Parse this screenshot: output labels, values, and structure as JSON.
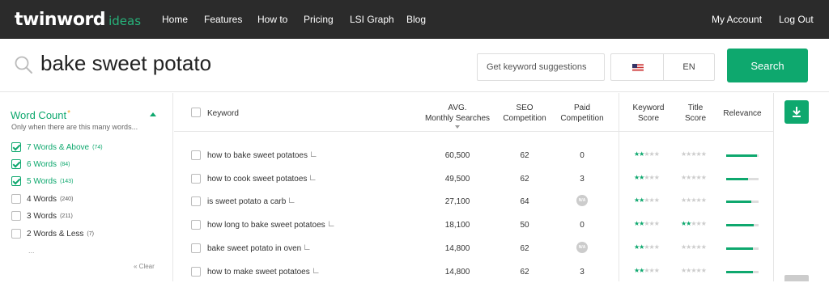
{
  "nav": {
    "logo_main": "twinword",
    "logo_sub": "ideas",
    "links": [
      "Home",
      "Features",
      "How to",
      "Pricing",
      "LSI Graph",
      "Blog"
    ],
    "account": "My Account",
    "logout": "Log Out"
  },
  "search": {
    "query": "bake sweet potato",
    "suggest_placeholder": "Get keyword suggestions",
    "language": "EN",
    "button": "Search"
  },
  "sidebar": {
    "title": "Word Count",
    "required_mark": "*",
    "subtitle": "Only when there are this many words...",
    "items": [
      {
        "label": "7 Words & Above",
        "count": "(74)",
        "checked": true
      },
      {
        "label": "6 Words",
        "count": "(84)",
        "checked": true
      },
      {
        "label": "5 Words",
        "count": "(143)",
        "checked": true
      },
      {
        "label": "4 Words",
        "count": "(240)",
        "checked": false
      },
      {
        "label": "3 Words",
        "count": "(211)",
        "checked": false
      },
      {
        "label": "2 Words & Less",
        "count": "(7)",
        "checked": false
      }
    ],
    "more": "...",
    "clear": "« Clear"
  },
  "table": {
    "headers": {
      "keyword": "Keyword",
      "avg_1": "AVG.",
      "avg_2": "Monthly Searches",
      "seo_1": "SEO",
      "seo_2": "Competition",
      "paid_1": "Paid",
      "paid_2": "Competition",
      "kscore_1": "Keyword",
      "kscore_2": "Score",
      "tscore_1": "Title",
      "tscore_2": "Score",
      "relevance": "Relevance"
    },
    "na_label": "N/A",
    "rows": [
      {
        "keyword": "how to bake sweet potatoes",
        "searches": "60,500",
        "seo": "62",
        "paid": "0",
        "kscore": 2,
        "tscore": 0,
        "relevance": 0.95
      },
      {
        "keyword": "how to cook sweet potatoes",
        "searches": "49,500",
        "seo": "62",
        "paid": "3",
        "kscore": 2,
        "tscore": 0,
        "relevance": 0.68
      },
      {
        "keyword": "is sweet potato a carb",
        "searches": "27,100",
        "seo": "64",
        "paid": "N/A",
        "kscore": 2,
        "tscore": 0,
        "relevance": 0.78
      },
      {
        "keyword": "how long to bake sweet potatoes",
        "searches": "18,100",
        "seo": "50",
        "paid": "0",
        "kscore": 2,
        "tscore": 2,
        "relevance": 0.85
      },
      {
        "keyword": "bake sweet potato in oven",
        "searches": "14,800",
        "seo": "62",
        "paid": "N/A",
        "kscore": 2,
        "tscore": 0,
        "relevance": 0.82
      },
      {
        "keyword": "how to make sweet potatoes",
        "searches": "14,800",
        "seo": "62",
        "paid": "3",
        "kscore": 2,
        "tscore": 0,
        "relevance": 0.82
      }
    ]
  },
  "colors": {
    "accent": "#0ea86e",
    "topbar": "#2b2b2b",
    "star_empty": "#cccccc"
  },
  "icons": {
    "search": "search-icon",
    "download": "download-icon",
    "flag": "us-flag-icon",
    "external": "external-link-icon"
  }
}
